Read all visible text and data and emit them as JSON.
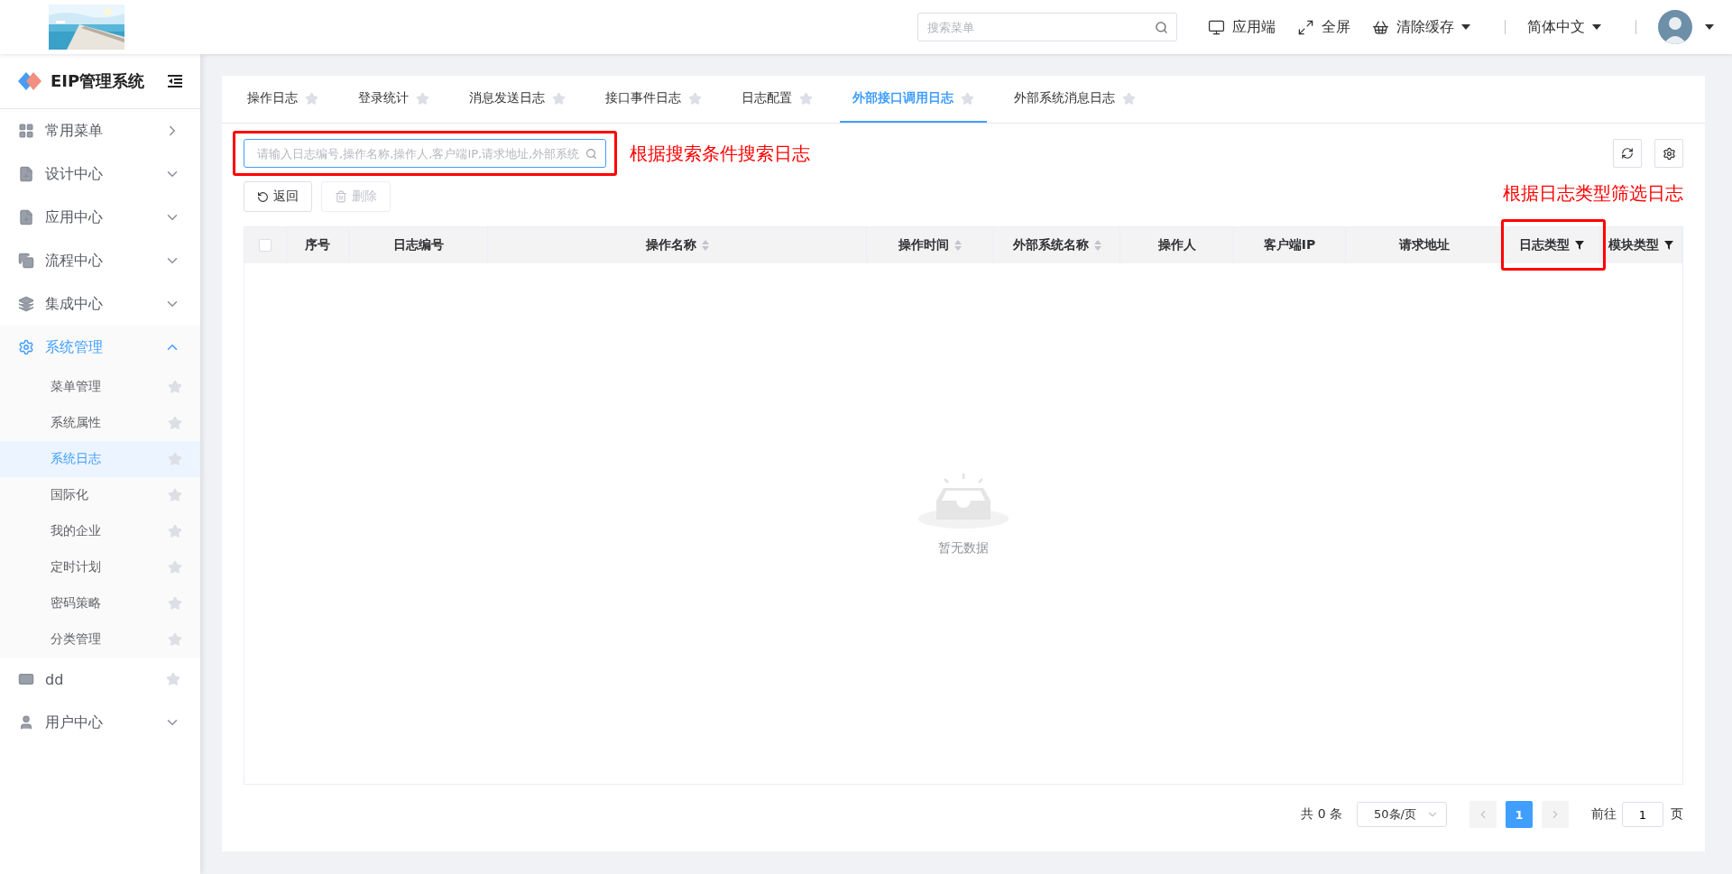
{
  "header": {
    "search": {
      "placeholder": "搜索菜单"
    },
    "actions": [
      {
        "label": "应用端",
        "kind": "monitor"
      },
      {
        "label": "全屏",
        "kind": "fullscreen"
      },
      {
        "label": "清除缓存",
        "kind": "clear"
      }
    ],
    "language": "简体中文"
  },
  "sidebar": {
    "title": "EIP管理系统",
    "items": [
      {
        "label": "常用菜单",
        "kind": "flyout"
      },
      {
        "label": "设计中心",
        "kind": "group",
        "expanded": false
      },
      {
        "label": "应用中心",
        "kind": "group",
        "expanded": false
      },
      {
        "label": "流程中心",
        "kind": "group",
        "expanded": false
      },
      {
        "label": "集成中心",
        "kind": "group",
        "expanded": false
      },
      {
        "label": "系统管理",
        "kind": "group",
        "expanded": true,
        "children": [
          {
            "label": "菜单管理",
            "selected": false
          },
          {
            "label": "系统属性",
            "selected": false
          },
          {
            "label": "系统日志",
            "selected": true
          },
          {
            "label": "国际化",
            "selected": false
          },
          {
            "label": "我的企业",
            "selected": false
          },
          {
            "label": "定时计划",
            "selected": false
          },
          {
            "label": "密码策略",
            "selected": false
          },
          {
            "label": "分类管理",
            "selected": false
          }
        ]
      },
      {
        "label": "dd",
        "kind": "page"
      },
      {
        "label": "用户中心",
        "kind": "group",
        "expanded": false
      }
    ]
  },
  "tabs": [
    {
      "label": "操作日志",
      "selected": false
    },
    {
      "label": "登录统计",
      "selected": false
    },
    {
      "label": "消息发送日志",
      "selected": false
    },
    {
      "label": "接口事件日志",
      "selected": false
    },
    {
      "label": "日志配置",
      "selected": false
    },
    {
      "label": "外部接口调用日志",
      "selected": true
    },
    {
      "label": "外部系统消息日志",
      "selected": false
    }
  ],
  "search": {
    "placeholder": "请输入日志编号,操作名称,操作人,客户端IP,请求地址,外部系统",
    "highlighted": true
  },
  "buttons": [
    {
      "label": "返回",
      "kind": "back",
      "disabled": false
    },
    {
      "label": "删除",
      "kind": "delete",
      "disabled": true
    }
  ],
  "annotations": [
    "根据搜索条件搜索日志",
    "根据日志类型筛选日志"
  ],
  "table": {
    "select_all": {
      "checked": false
    },
    "columns": [
      {
        "label": "序号",
        "kind": "plain",
        "highlighted": false
      },
      {
        "label": "日志编号",
        "kind": "plain",
        "highlighted": false
      },
      {
        "label": "操作名称",
        "kind": "sortable",
        "highlighted": false
      },
      {
        "label": "操作时间",
        "kind": "sortable",
        "highlighted": false
      },
      {
        "label": "外部系统名称",
        "kind": "sortable",
        "highlighted": false
      },
      {
        "label": "操作人",
        "kind": "plain",
        "highlighted": false
      },
      {
        "label": "客户端IP",
        "kind": "plain",
        "highlighted": false
      },
      {
        "label": "请求地址",
        "kind": "plain",
        "highlighted": false
      },
      {
        "label": "日志类型",
        "kind": "filter",
        "highlighted": true
      },
      {
        "label": "模块类型",
        "kind": "filter",
        "highlighted": false
      }
    ],
    "empty_text": "暂无数据"
  },
  "pagination": {
    "total": "共 0 条",
    "page_size": "50条/页",
    "pages": [
      {
        "label": "1",
        "selected": true
      }
    ],
    "goto_label": "前往",
    "goto_value": "1",
    "goto_suffix": "页"
  }
}
